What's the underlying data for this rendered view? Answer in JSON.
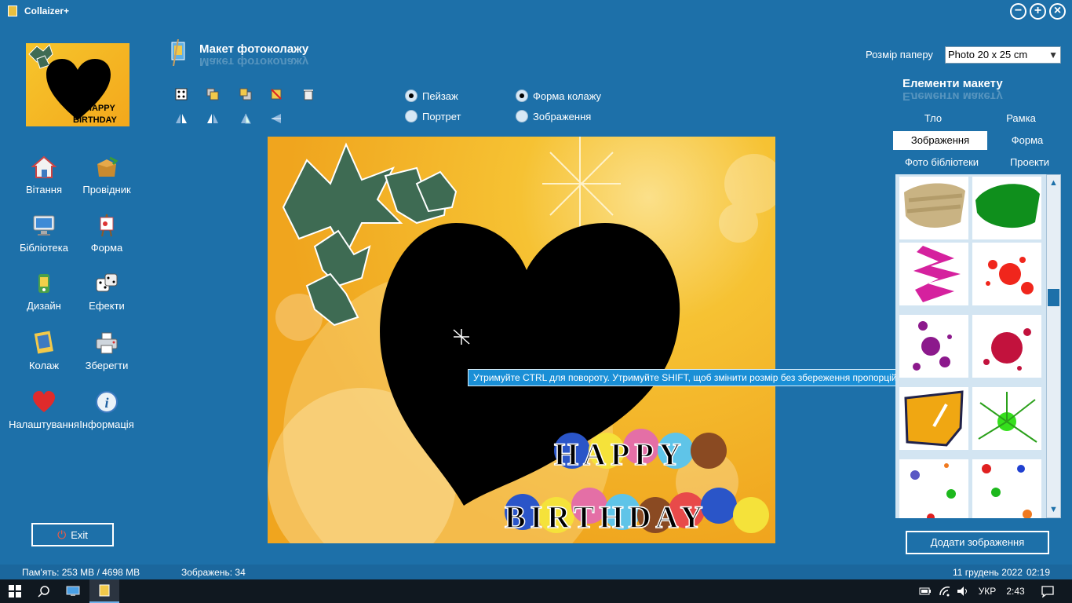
{
  "window": {
    "title": "Collaizer+",
    "minimize": "−",
    "maximize": "+",
    "close": "×"
  },
  "nav": [
    {
      "label": "Вітання",
      "icon": "home-icon"
    },
    {
      "label": "Провідник",
      "icon": "open-box-icon"
    },
    {
      "label": "Бібліотека",
      "icon": "monitor-icon"
    },
    {
      "label": "Форма",
      "icon": "easel-icon"
    },
    {
      "label": "Дизайн",
      "icon": "design-icon"
    },
    {
      "label": "Ефекти",
      "icon": "dice-icon"
    },
    {
      "label": "Колаж",
      "icon": "collage-icon"
    },
    {
      "label": "Зберегти",
      "icon": "printer-icon"
    },
    {
      "label": "Налаштування",
      "icon": "heart-icon"
    },
    {
      "label": "Інформація",
      "icon": "info-icon"
    }
  ],
  "exit_label": "Exit",
  "layout": {
    "title": "Макет фотоколажу"
  },
  "orientation": {
    "landscape": "Пейзаж",
    "portrait": "Портрет",
    "selected": "landscape"
  },
  "mode": {
    "shape": "Форма колажу",
    "image": "Зображення",
    "selected": "shape"
  },
  "tooltip": "Утримуйте CTRL для повороту. Утримуйте SHIFT, щоб змінити розмір без збереження пропорцій.",
  "canvas": {
    "happy": "HAPPY",
    "birthday": "BIRTHDAY"
  },
  "paper": {
    "label": "Розмір паперу",
    "value": "Photo 20 x 25 cm"
  },
  "elements": {
    "title": "Елементи макету",
    "tabs": [
      "Тло",
      "Рамка",
      "Зображення",
      "Форма",
      "Фото бібліотеки",
      "Проекти"
    ],
    "active_tab": "Зображення"
  },
  "add_button": "Додати зображення",
  "status": {
    "memory": "Пам'ять: 253 MB / 4698 MB",
    "images": "Зображень: 34",
    "date": "11 грудень 2022",
    "time": "02:19"
  },
  "taskbar": {
    "lang": "УКР",
    "clock": "2:43"
  },
  "colors": {
    "accent": "#1d70a9",
    "canvas": "#f6c233",
    "tooltip": "#1a8fd6"
  }
}
